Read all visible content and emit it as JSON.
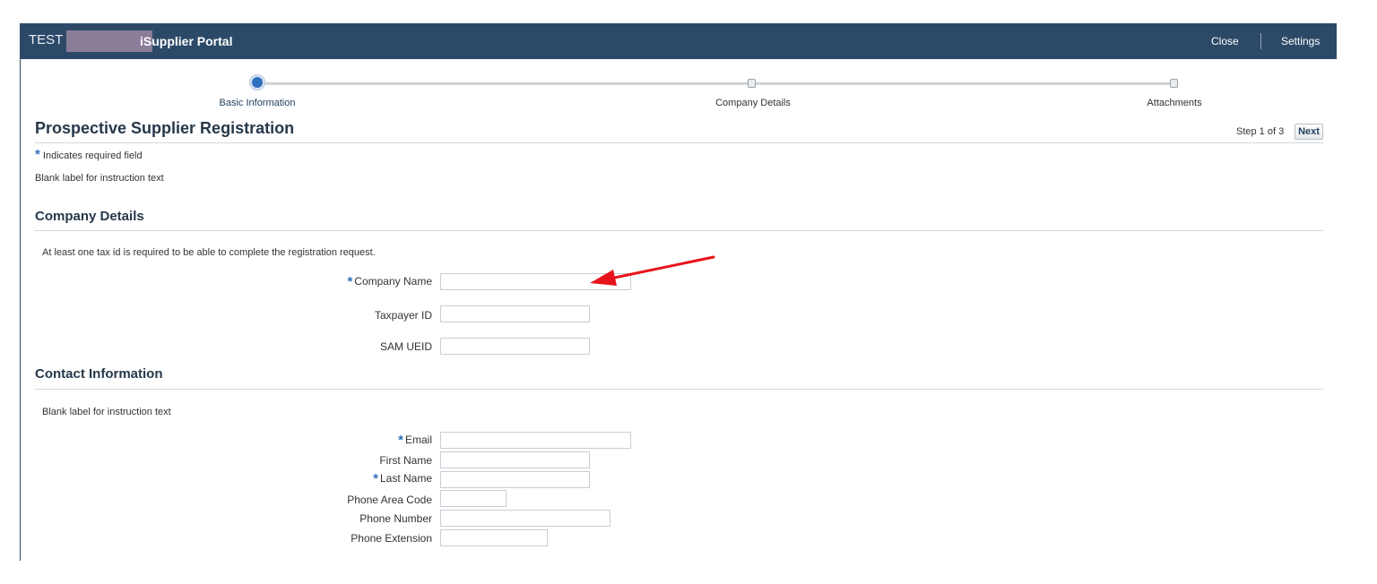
{
  "header": {
    "environment": "TEST",
    "app_title": "iSupplier Portal",
    "close_label": "Close",
    "settings_label": "Settings"
  },
  "train": {
    "steps": [
      {
        "label": "Basic Information",
        "active": true
      },
      {
        "label": "Company Details",
        "active": false
      },
      {
        "label": "Attachments",
        "active": false
      }
    ]
  },
  "page": {
    "title": "Prospective Supplier Registration",
    "step_indicator": "Step 1 of 3",
    "next_label": "Next",
    "required_note": "Indicates required field",
    "instruction": "Blank label for instruction text"
  },
  "company_details": {
    "heading": "Company Details",
    "instruction": "At least one tax id is required to be able to complete the registration request.",
    "fields": {
      "company_name": {
        "label": "Company Name",
        "required": true,
        "value": ""
      },
      "taxpayer_id": {
        "label": "Taxpayer ID",
        "required": false,
        "value": ""
      },
      "sam_ueid": {
        "label": "SAM UEID",
        "required": false,
        "value": ""
      }
    }
  },
  "contact_information": {
    "heading": "Contact Information",
    "instruction": "Blank label for instruction text",
    "fields": {
      "email": {
        "label": "Email",
        "required": true,
        "value": ""
      },
      "first_name": {
        "label": "First Name",
        "required": false,
        "value": ""
      },
      "last_name": {
        "label": "Last Name",
        "required": true,
        "value": ""
      },
      "phone_area_code": {
        "label": "Phone Area Code",
        "required": false,
        "value": ""
      },
      "phone_number": {
        "label": "Phone Number",
        "required": false,
        "value": ""
      },
      "phone_extension": {
        "label": "Phone Extension",
        "required": false,
        "value": ""
      }
    }
  },
  "colors": {
    "header_bg": "#2c4a68",
    "required_star": "#2f6fbf",
    "annotation_arrow": "#e8141c"
  },
  "icons": {
    "required": "asterisk-icon",
    "annotation": "red-arrow-icon"
  }
}
